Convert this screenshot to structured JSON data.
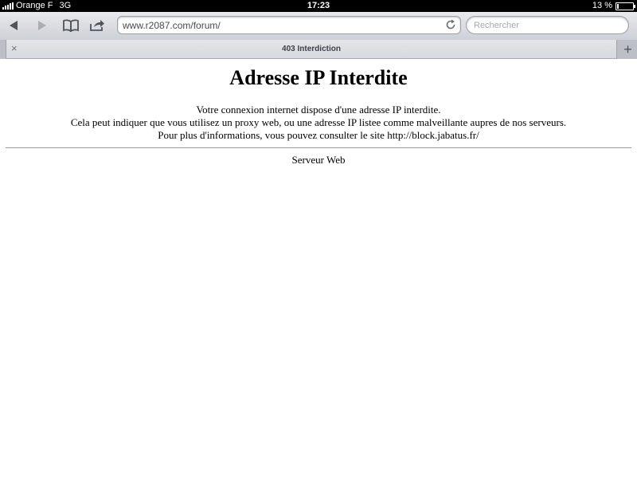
{
  "status_bar": {
    "carrier": "Orange F",
    "network": "3G",
    "time": "17:23",
    "battery_text": "13 %",
    "battery_level": 0.13
  },
  "toolbar": {
    "url": "www.r2087.com/forum/",
    "search_placeholder": "Rechercher"
  },
  "tab": {
    "title": "403 Interdiction",
    "close_glyph": "×",
    "new_tab_glyph": "+"
  },
  "page": {
    "heading": "Adresse IP Interdite",
    "lines": [
      "Votre connexion internet dispose d'une adresse IP interdite.",
      "Cela peut indiquer que vous utilisez un proxy web, ou une adresse IP listee comme malveillante aupres de nos serveurs.",
      "Pour plus d'informations, vous pouvez consulter le site http://block.jabatus.fr/"
    ],
    "footer": "Serveur Web"
  },
  "icons": {
    "back": "back-arrow-icon",
    "forward": "forward-arrow-icon",
    "bookmarks": "bookmarks-icon",
    "share": "share-icon",
    "reload": "reload-icon",
    "close_tab": "close-icon",
    "new_tab": "plus-icon"
  }
}
